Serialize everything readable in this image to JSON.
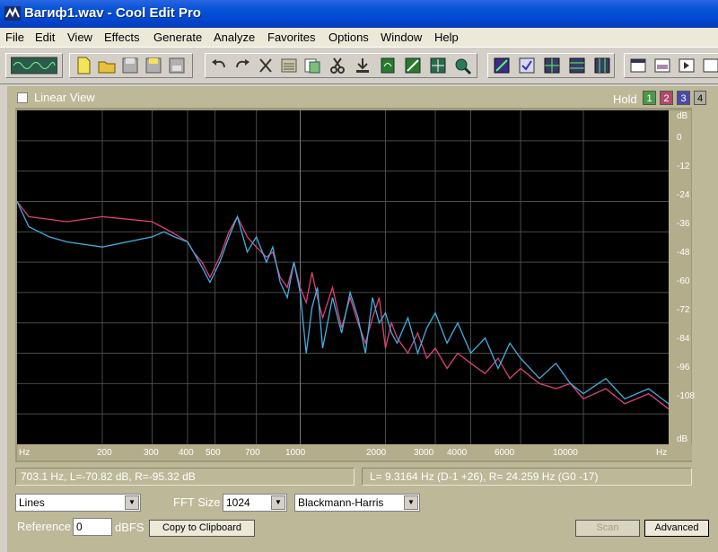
{
  "window": {
    "title": "Вагиф1.wav - Cool Edit Pro"
  },
  "menu": [
    "File",
    "Edit",
    "View",
    "Effects",
    "Generate",
    "Analyze",
    "Favorites",
    "Options",
    "Window",
    "Help"
  ],
  "toolbar": {
    "buttons": [
      "mode-toggle-icon",
      "new-file-icon",
      "open-file-icon",
      "save-icon",
      "save-as-icon",
      "save-all-icon",
      "undo-icon",
      "redo-icon",
      "cut-icon",
      "copy-icon",
      "paste-icon",
      "scissors-icon",
      "download-icon",
      "tool-icon",
      "tool-icon",
      "tool-icon",
      "tool-icon",
      "grid-icon",
      "grid-icon",
      "grid-icon",
      "grid-icon",
      "window-icon",
      "window-icon",
      "window-icon"
    ]
  },
  "view": {
    "linear_view_label": "Linear View",
    "linear_view_checked": false
  },
  "hold": {
    "label": "Hold",
    "slots": [
      "1",
      "2",
      "3",
      "4"
    ],
    "colors": [
      "#4a9a4a",
      "#b04a6a",
      "#4a4aaa",
      "#b0b0a0"
    ]
  },
  "axes": {
    "db_unit_top": "dB",
    "db_unit_bottom": "dB",
    "db_ticks": [
      "0",
      "-12",
      "-24",
      "-36",
      "-48",
      "-60",
      "-72",
      "-84",
      "-96",
      "-108"
    ],
    "hz_unit_left": "Hz",
    "hz_unit_right": "Hz",
    "hz_ticks": [
      "200",
      "300",
      "400",
      "500",
      "700",
      "1000",
      "2000",
      "3000",
      "4000",
      "6000",
      "10000"
    ]
  },
  "chart_data": {
    "type": "line",
    "xlabel": "Hz",
    "ylabel": "dB",
    "x_scale": "log",
    "ylim": [
      -120,
      12
    ],
    "series": [
      {
        "color": "#e0407a",
        "x": [
          100,
          110,
          150,
          200,
          300,
          350,
          400,
          420,
          450,
          480,
          520,
          560,
          600,
          650,
          700,
          760,
          800,
          850,
          900,
          950,
          1000,
          1050,
          1100,
          1150,
          1200,
          1300,
          1400,
          1500,
          1600,
          1700,
          1800,
          1900,
          2000,
          2100,
          2200,
          2400,
          2600,
          2800,
          3000,
          3300,
          3600,
          4000,
          4500,
          5000,
          5500,
          6000,
          7000,
          8000,
          9000,
          10000,
          12000,
          14000,
          17000,
          20000,
          21000
        ],
        "y": [
          -24,
          -30,
          -32,
          -30,
          -32,
          -36,
          -40,
          -44,
          -48,
          -54,
          -46,
          -36,
          -30,
          -38,
          -42,
          -46,
          -44,
          -54,
          -58,
          -48,
          -58,
          -64,
          -52,
          -62,
          -70,
          -58,
          -74,
          -62,
          -72,
          -80,
          -70,
          -62,
          -82,
          -72,
          -78,
          -84,
          -76,
          -86,
          -82,
          -90,
          -84,
          -88,
          -92,
          -86,
          -94,
          -90,
          -96,
          -98,
          -96,
          -102,
          -98,
          -104,
          -100,
          -106,
          -102
        ]
      },
      {
        "color": "#40b0e0",
        "x": [
          100,
          110,
          130,
          150,
          200,
          300,
          330,
          360,
          400,
          420,
          450,
          480,
          520,
          560,
          600,
          650,
          700,
          760,
          800,
          850,
          900,
          950,
          1000,
          1050,
          1100,
          1150,
          1200,
          1300,
          1400,
          1500,
          1600,
          1700,
          1800,
          1900,
          2000,
          2100,
          2200,
          2400,
          2600,
          2800,
          3000,
          3300,
          3600,
          4000,
          4500,
          5000,
          5500,
          6000,
          7000,
          8000,
          9000,
          10000,
          12000,
          14000,
          17000,
          20000,
          21000
        ],
        "y": [
          -24,
          -34,
          -38,
          -40,
          -42,
          -38,
          -36,
          -38,
          -40,
          -44,
          -50,
          -56,
          -48,
          -38,
          -30,
          -44,
          -38,
          -48,
          -42,
          -56,
          -62,
          -48,
          -60,
          -84,
          -66,
          -58,
          -82,
          -62,
          -76,
          -60,
          -70,
          -84,
          -62,
          -72,
          -68,
          -76,
          -80,
          -70,
          -84,
          -74,
          -68,
          -80,
          -72,
          -84,
          -78,
          -90,
          -80,
          -86,
          -94,
          -88,
          -96,
          -100,
          -94,
          -102,
          -98,
          -104,
          -108
        ]
      }
    ]
  },
  "status": {
    "cursor_readout": "703.1 Hz, L=-70.82 dB, R=-95.32 dB",
    "peak_readout": "L= 9.3164 Hz (D-1 +26), R= 24.259 Hz (G0 -17)"
  },
  "controls": {
    "plot_style": "Lines",
    "fft_size_label": "FFT Size",
    "fft_size": "1024",
    "window_function": "Blackmann-Harris",
    "reference_label": "Reference",
    "reference_value": "0",
    "reference_unit": "dBFS",
    "copy_button": "Copy to Clipboard",
    "scan_button": "Scan",
    "advanced_button": "Advanced"
  }
}
